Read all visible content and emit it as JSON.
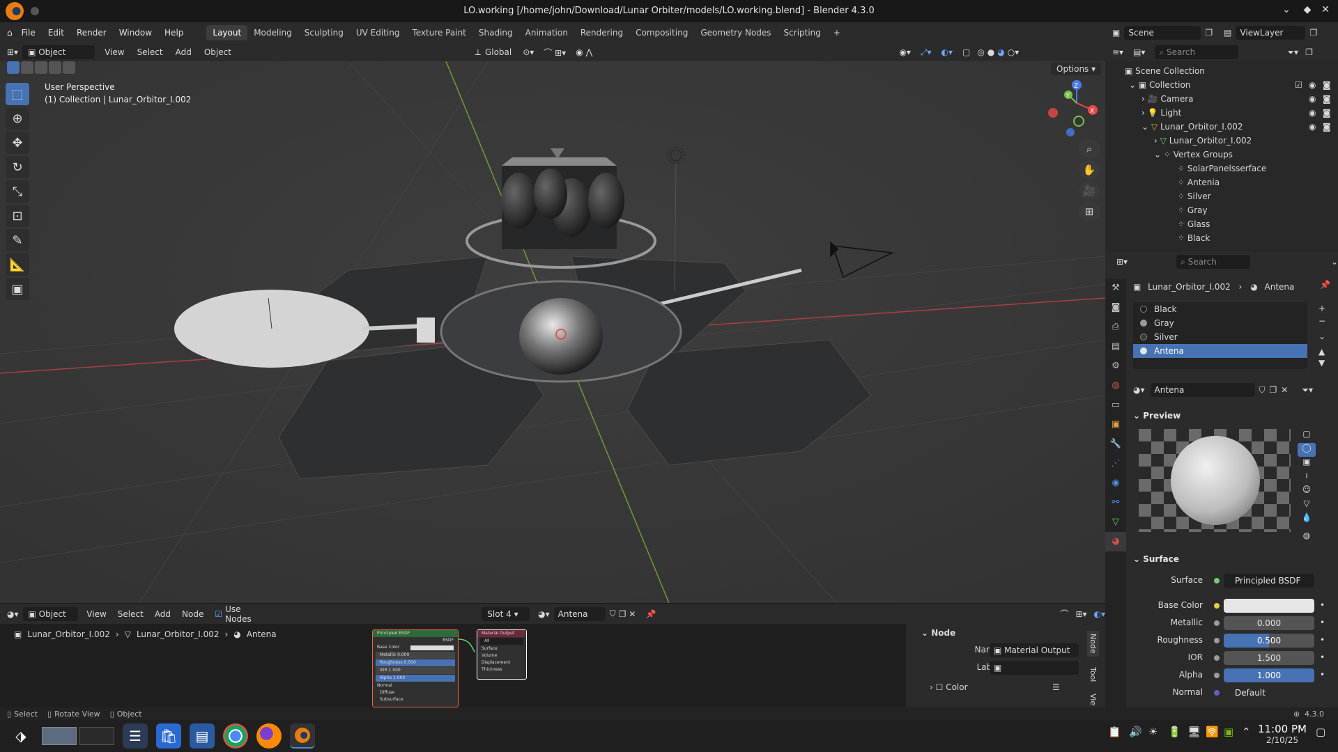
{
  "window": {
    "title": "LO.working [/home/john/Download/Lunar Orbiter/models/LO.working.blend] - Blender 4.3.0"
  },
  "menu": [
    "File",
    "Edit",
    "Render",
    "Window",
    "Help"
  ],
  "workspaces": [
    "Layout",
    "Modeling",
    "Sculpting",
    "UV Editing",
    "Texture Paint",
    "Shading",
    "Animation",
    "Rendering",
    "Compositing",
    "Geometry Nodes",
    "Scripting"
  ],
  "active_workspace": "Layout",
  "top_right": {
    "scene": "Scene",
    "view_layer": "ViewLayer"
  },
  "viewport_header": {
    "mode": "Object Mode",
    "menus": [
      "View",
      "Select",
      "Add",
      "Object"
    ],
    "transform": "Global",
    "options": "Options"
  },
  "viewport": {
    "perspective_label": "User Perspective",
    "collection_label": "(1) Collection | Lunar_Orbitor_I.002",
    "gizmo": {
      "x": "X",
      "y": "Y",
      "z": "Z"
    }
  },
  "outliner": {
    "search_placeholder": "Search",
    "root": "Scene Collection",
    "items": [
      {
        "label": "Collection",
        "indent": 0
      },
      {
        "label": "Camera",
        "indent": 1
      },
      {
        "label": "Light",
        "indent": 1
      },
      {
        "label": "Lunar_Orbitor_I.002",
        "indent": 1
      },
      {
        "label": "Lunar_Orbitor_I.002",
        "indent": 2
      },
      {
        "label": "Vertex Groups",
        "indent": 2
      },
      {
        "label": "SolarPanelsserface",
        "indent": 3
      },
      {
        "label": "Antenia",
        "indent": 3
      },
      {
        "label": "Silver",
        "indent": 3
      },
      {
        "label": "Gray",
        "indent": 3
      },
      {
        "label": "Glass",
        "indent": 3
      },
      {
        "label": "Black",
        "indent": 3
      }
    ]
  },
  "properties": {
    "search_placeholder": "Search",
    "breadcrumb": [
      "Lunar_Orbitor_I.002",
      "Antena"
    ],
    "materials": [
      {
        "name": "Black",
        "color": "#1c1c1c"
      },
      {
        "name": "Gray",
        "color": "#9a9a9a"
      },
      {
        "name": "Silver",
        "color": "#3a3a3a"
      },
      {
        "name": "Antena",
        "color": "#e6e6e6"
      }
    ],
    "selected_material": "Antena",
    "material_name": "Antena",
    "preview_label": "Preview",
    "surface_label": "Surface",
    "fields": {
      "surface": {
        "label": "Surface",
        "value": "Principled BSDF"
      },
      "base_color": {
        "label": "Base Color"
      },
      "metallic": {
        "label": "Metallic",
        "value": "0.000"
      },
      "roughness": {
        "label": "Roughness",
        "value": "0.500",
        "fraction": 0.5
      },
      "ior": {
        "label": "IOR",
        "value": "1.500"
      },
      "alpha": {
        "label": "Alpha",
        "value": "1.000",
        "fraction": 1.0
      },
      "normal": {
        "label": "Normal",
        "value": "Default"
      }
    }
  },
  "node_editor": {
    "editor_type": "Object",
    "menus": [
      "View",
      "Select",
      "Add",
      "Node"
    ],
    "use_nodes": "Use Nodes",
    "slot": "Slot 4",
    "material": "Antena",
    "breadcrumb": [
      "Lunar_Orbitor_I.002",
      "Lunar_Orbitor_I.002",
      "Antena"
    ],
    "nodes": {
      "bsdf": {
        "title": "Principled BSDF",
        "rows": [
          "BSDF",
          "Base Color",
          "Metallic   0.000",
          "Roughness  0.500",
          "IOR        1.500",
          "Alpha      1.000",
          "Normal",
          "Diffuse",
          "Subsurface"
        ]
      },
      "output": {
        "title": "Material Output",
        "rows": [
          "All",
          "Surface",
          "Volume",
          "Displacement",
          "Thickness"
        ]
      }
    },
    "side_panel": {
      "section": "Node",
      "name_label": "Name",
      "name_value": "Material Output",
      "label_label": "Label",
      "color_section": "Color",
      "tabs": [
        "Node",
        "Tool",
        "View"
      ]
    }
  },
  "statusbar": {
    "items": [
      "Select",
      "Rotate View",
      "Object"
    ],
    "version": "4.3.0"
  },
  "taskbar": {
    "time": "11:00 PM",
    "date": "2/10/25"
  }
}
